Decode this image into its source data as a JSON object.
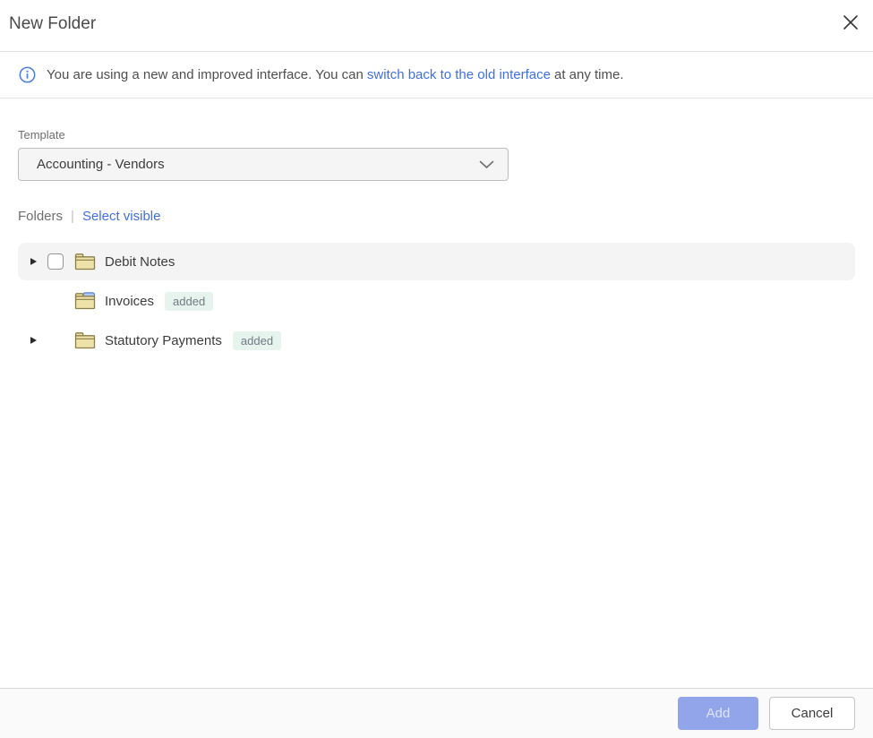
{
  "dialog": {
    "title": "New Folder"
  },
  "banner": {
    "text_before": "You are using a new and improved interface. You can",
    "link_text": "switch back to the old interface",
    "text_after": "at any time."
  },
  "template": {
    "label": "Template",
    "selected_value": "Accounting - Vendors"
  },
  "folders_header": {
    "label": "Folders",
    "separator": "|",
    "select_visible_link": "Select visible"
  },
  "tree": {
    "rows": [
      {
        "label": "Debit Notes",
        "badge": "",
        "expander": true,
        "checkbox": true,
        "checked": false,
        "highlighted": true,
        "folder_style": "plain"
      },
      {
        "label": "Invoices",
        "badge": "added",
        "expander": false,
        "checkbox": false,
        "highlighted": false,
        "folder_style": "blue-tab"
      },
      {
        "label": "Statutory Payments",
        "badge": "added",
        "expander": true,
        "checkbox": false,
        "highlighted": false,
        "folder_style": "plain"
      }
    ]
  },
  "footer": {
    "add_label": "Add",
    "add_enabled": false,
    "cancel_label": "Cancel"
  },
  "colors": {
    "accent_link_blue": "#3f6fe3",
    "info_icon_blue": "#4a7de0",
    "add_button_bg": "#93a5ea",
    "badge_bg": "#e7f4ed",
    "badge_text": "#6f7a85",
    "row_highlight": "#f4f4f4",
    "folder_fill": "#ede3a9",
    "folder_stroke": "#8a7d48"
  }
}
